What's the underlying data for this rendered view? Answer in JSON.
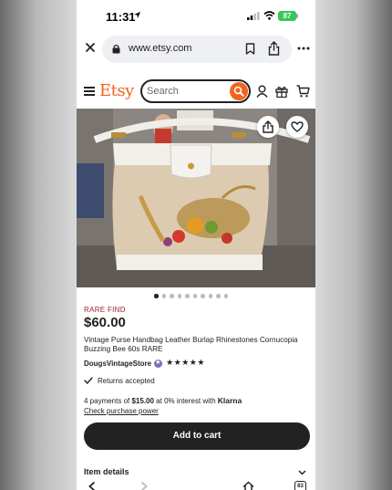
{
  "status_bar": {
    "time": "11:31",
    "battery": "87"
  },
  "browser": {
    "url": "www.etsy.com"
  },
  "header": {
    "logo": "Etsy",
    "search_placeholder": "Search"
  },
  "carousel": {
    "total": 10,
    "active": 0
  },
  "product": {
    "badge": "RARE FIND",
    "price": "$60.00",
    "title": "Vintage Purse Handbag Leather Burlap Rhinestones Cornucopia Buzzing Bee 60s RARE",
    "shop_name": "DougsVintageStore",
    "rating_stars": "★★★★★",
    "returns": "Returns accepted",
    "installments_prefix": "4 payments of ",
    "installment_amount": "$15.00",
    "installments_suffix": " at 0% interest with ",
    "klarna": "Klarna",
    "check_power": "Check purchase power",
    "add_to_cart": "Add to cart",
    "item_details": "Item details"
  },
  "toolbar": {
    "tab_count": "83"
  },
  "colors": {
    "etsy_orange": "#f1641e",
    "rare_find": "#a61a2e",
    "cart_button": "#222222"
  }
}
